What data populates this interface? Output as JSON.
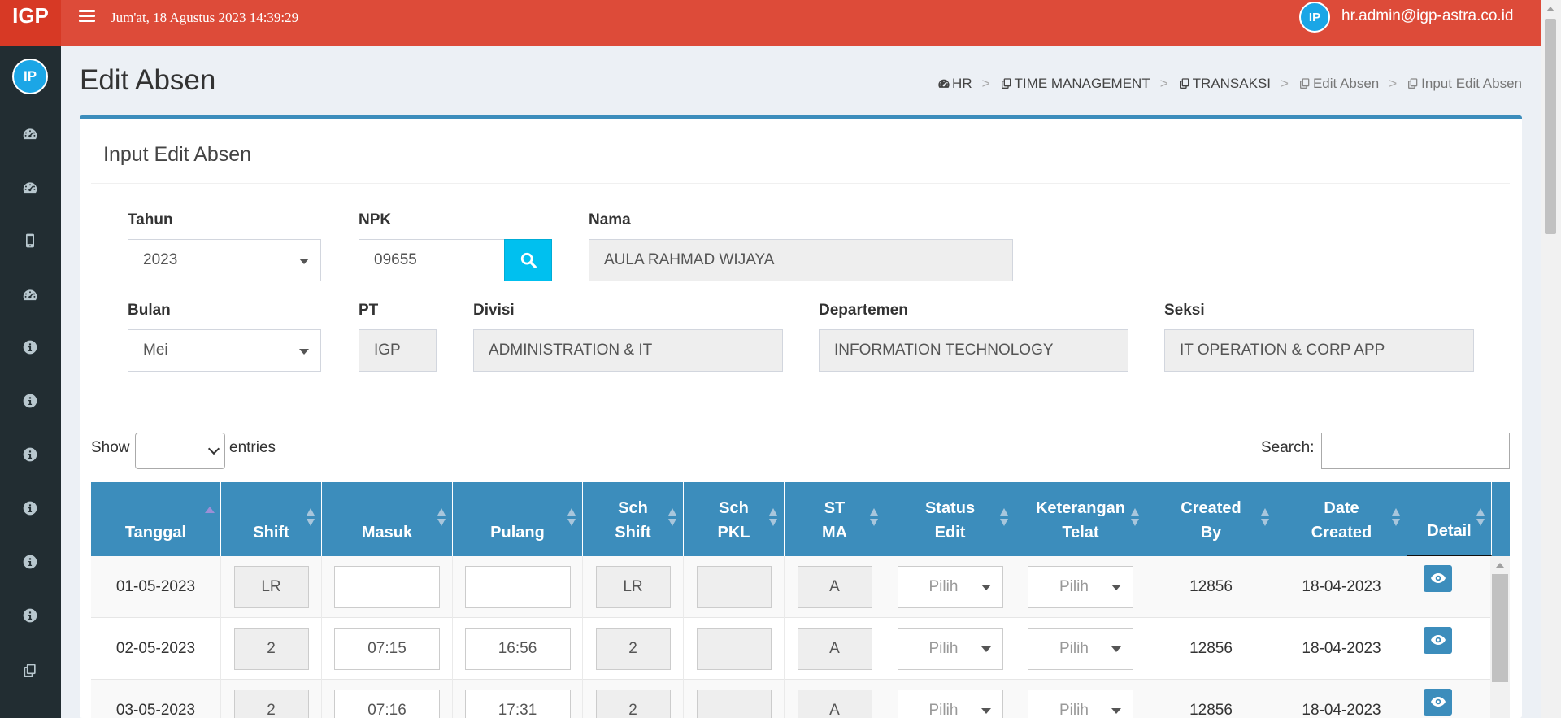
{
  "header": {
    "logo": "IGP",
    "datetime": "Jum'at, 18 Agustus 2023 14:39:29",
    "avatar_initials": "IP",
    "user_email": "hr.admin@igp-astra.co.id"
  },
  "sidebar": {
    "avatar_initials": "IP",
    "icons": [
      "dashboard-icon",
      "dashboard-icon",
      "mobile-icon",
      "dashboard-icon",
      "info-icon",
      "info-icon",
      "info-icon",
      "info-icon",
      "info-icon",
      "info-icon",
      "copy-icon"
    ]
  },
  "page": {
    "title": "Edit Absen"
  },
  "breadcrumb": [
    {
      "label": "HR",
      "icon": "dashboard-icon"
    },
    {
      "label": "TIME MANAGEMENT",
      "icon": "copy-icon"
    },
    {
      "label": "TRANSAKSI",
      "icon": "copy-icon"
    },
    {
      "label": "Edit Absen",
      "icon": "copy-icon"
    },
    {
      "label": "Input Edit Absen",
      "icon": "copy-icon"
    }
  ],
  "form": {
    "box_title": "Input Edit Absen",
    "tahun": {
      "label": "Tahun",
      "value": "2023"
    },
    "npk": {
      "label": "NPK",
      "value": "09655"
    },
    "nama": {
      "label": "Nama",
      "value": "AULA RAHMAD WIJAYA"
    },
    "bulan": {
      "label": "Bulan",
      "value": "Mei"
    },
    "pt": {
      "label": "PT",
      "value": "IGP"
    },
    "divisi": {
      "label": "Divisi",
      "value": "ADMINISTRATION & IT"
    },
    "departemen": {
      "label": "Departemen",
      "value": "INFORMATION TECHNOLOGY"
    },
    "seksi": {
      "label": "Seksi",
      "value": "IT OPERATION & CORP APP"
    }
  },
  "datatable": {
    "show_label": "Show",
    "entries_label": "entries",
    "search_label": "Search:",
    "columns": [
      [
        "Tanggal"
      ],
      [
        "Shift"
      ],
      [
        "Masuk"
      ],
      [
        "Pulang"
      ],
      [
        "Sch",
        "Shift"
      ],
      [
        "Sch",
        "PKL"
      ],
      [
        "ST",
        "MA"
      ],
      [
        "Status",
        "Edit"
      ],
      [
        "Keterangan",
        "Telat"
      ],
      [
        "Created",
        "By"
      ],
      [
        "Date",
        "Created"
      ],
      [
        "Detail"
      ]
    ],
    "rows": [
      {
        "tanggal": "01-05-2023",
        "shift": "LR",
        "masuk": "",
        "pulang": "",
        "sch_shift": "LR",
        "sch_pkl": "",
        "st_ma": "A",
        "status_edit": "Pilih",
        "ket_telat": "Pilih",
        "created_by": "12856",
        "date_created": "18-04-2023"
      },
      {
        "tanggal": "02-05-2023",
        "shift": "2",
        "masuk": "07:15",
        "pulang": "16:56",
        "sch_shift": "2",
        "sch_pkl": "",
        "st_ma": "A",
        "status_edit": "Pilih",
        "ket_telat": "Pilih",
        "created_by": "12856",
        "date_created": "18-04-2023"
      },
      {
        "tanggal": "03-05-2023",
        "shift": "2",
        "masuk": "07:16",
        "pulang": "17:31",
        "sch_shift": "2",
        "sch_pkl": "",
        "st_ma": "A",
        "status_edit": "Pilih",
        "ket_telat": "Pilih",
        "created_by": "12856",
        "date_created": "18-04-2023"
      }
    ]
  },
  "colors": {
    "header_red": "#dd4b39",
    "logo_red": "#d73925",
    "sidebar_dark": "#222d32",
    "primary_blue": "#3c8dbc",
    "info_cyan": "#00c0ef"
  }
}
